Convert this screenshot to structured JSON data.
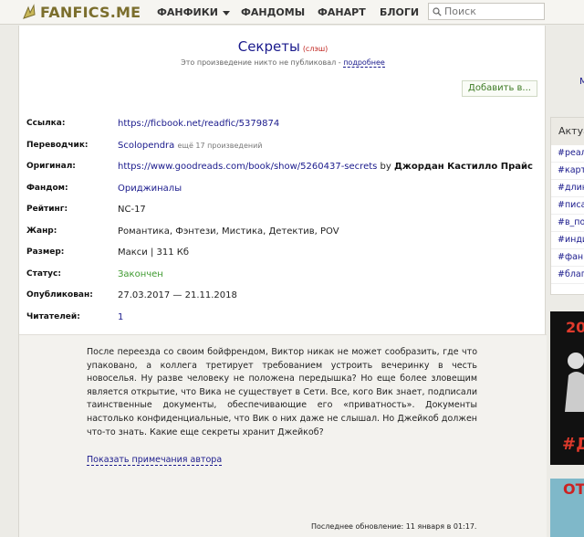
{
  "header": {
    "logo": "FANFICS.ME",
    "nav": [
      {
        "label": "ФАНФИКИ"
      },
      {
        "label": "ФАНДОМЫ"
      },
      {
        "label": "ФАНАРТ"
      },
      {
        "label": "БЛОГИ"
      }
    ],
    "search_placeholder": "Поиск"
  },
  "work": {
    "title": "Секреты",
    "tag": "(слэш)",
    "pub_note": "Это произведение никто не публиковал - ",
    "pub_more": "подробнее",
    "add_button": "Добавить в...",
    "meta": {
      "link_label": "Ссылка:",
      "link_value": "https://ficbook.net/readfic/5379874",
      "translator_label": "Переводчик:",
      "translator_name": "Scolopendra",
      "translator_more": "ещё 17 произведений",
      "original_label": "Оригинал:",
      "original_url": "https://www.goodreads.com/book/show/5260437-secrets",
      "original_by": " by ",
      "original_author": "Джордан Кастилло Прайс",
      "fandom_label": "Фандом:",
      "fandom_value": "Ориджиналы",
      "rating_label": "Рейтинг:",
      "rating_value": "NC-17",
      "genre_label": "Жанр:",
      "genre_value": "Романтика, Фэнтези, Мистика, Детектив, POV",
      "size_label": "Размер:",
      "size_value": "Макси | 311 Кб",
      "status_label": "Статус:",
      "status_value": "Закончен",
      "published_label": "Опубликован:",
      "published_value": "27.03.2017 — 21.11.2018",
      "readers_label": "Читателей:",
      "readers_value": "1"
    },
    "summary": "После переезда со своим бойфрендом, Виктор никак не может сообразить, где что упаковано, а коллега третирует требованием устроить вечеринку в честь новоселья. Ну разве человеку не положена передышка? Но еще более зловещим является открытие, что Вика не существует в Сети. Все, кого Вик знает, подписали таинственные документы, обеспечивающие его «приватность». Документы настолько конфиденциальные, что Вик о них даже не слышал. Но Джейкоб должен что-то знать. Какие еще секреты хранит Джейкоб?",
    "author_notes": "Показать примечания автора",
    "updated": "Последнее обновление: 11 января в 01:17."
  },
  "sidebar": {
    "m_link": "М",
    "actual_title": "Актуальное",
    "tags": [
      "#реал",
      "#карт",
      "#длин",
      "#писа",
      "#в_по",
      "#инди",
      "#фан",
      "#благ"
    ],
    "banner1_num": "20",
    "banner1_hash": "#Д",
    "banner2_text": "ОТ"
  },
  "colors": {
    "link": "#1a1a8c",
    "tag_red": "#c0241f",
    "status_green": "#3e9a2f",
    "logo_gold": "#7b6e2d"
  }
}
